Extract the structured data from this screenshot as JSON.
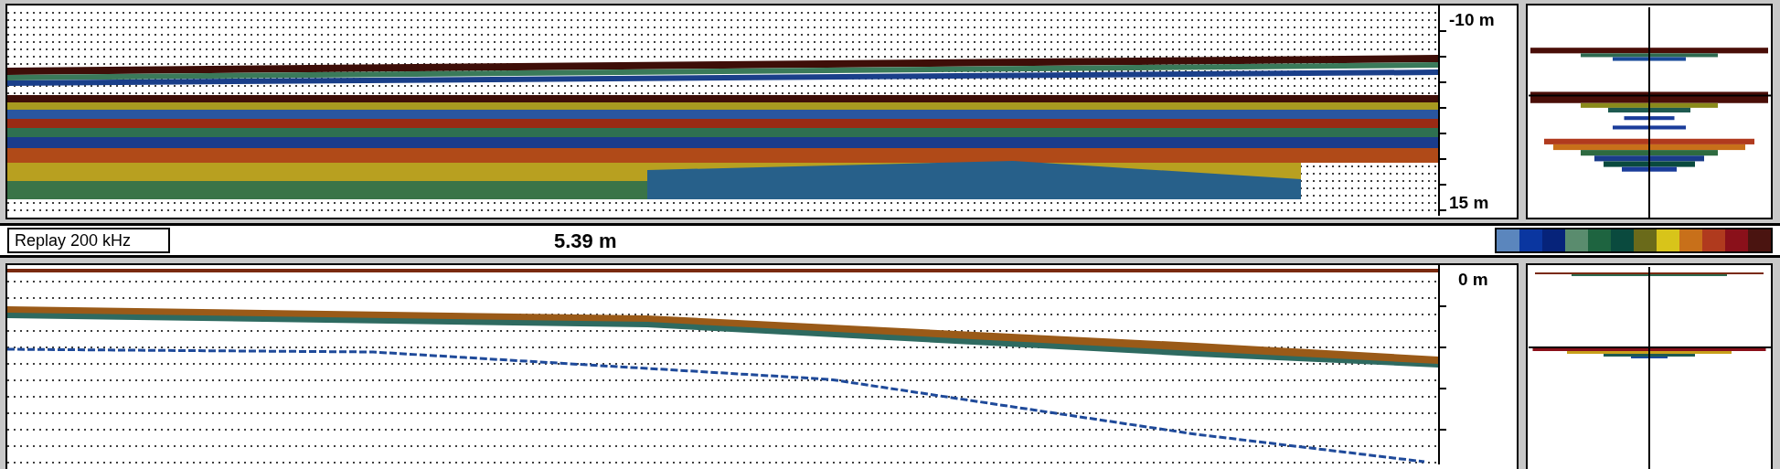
{
  "top_echogram": {
    "depth_labels": [
      "-10 m",
      "15 m"
    ]
  },
  "status_bar": {
    "mode": "Replay 200 kHz",
    "depth": "5.39 m",
    "color_scale": [
      {
        "color": "#5b86bd"
      },
      {
        "color": "#0a36a0"
      },
      {
        "color": "#06237a"
      },
      {
        "color": "#5a8c6e"
      },
      {
        "color": "#1e6440"
      },
      {
        "color": "#0a4a3e"
      },
      {
        "color": "#6a6a1a"
      },
      {
        "color": "#d8c41a"
      },
      {
        "color": "#c8701a"
      },
      {
        "color": "#b03a1e"
      },
      {
        "color": "#8a101a"
      },
      {
        "color": "#4a1410"
      }
    ]
  },
  "bottom_echogram": {
    "depth_labels": [
      "0 m"
    ]
  }
}
